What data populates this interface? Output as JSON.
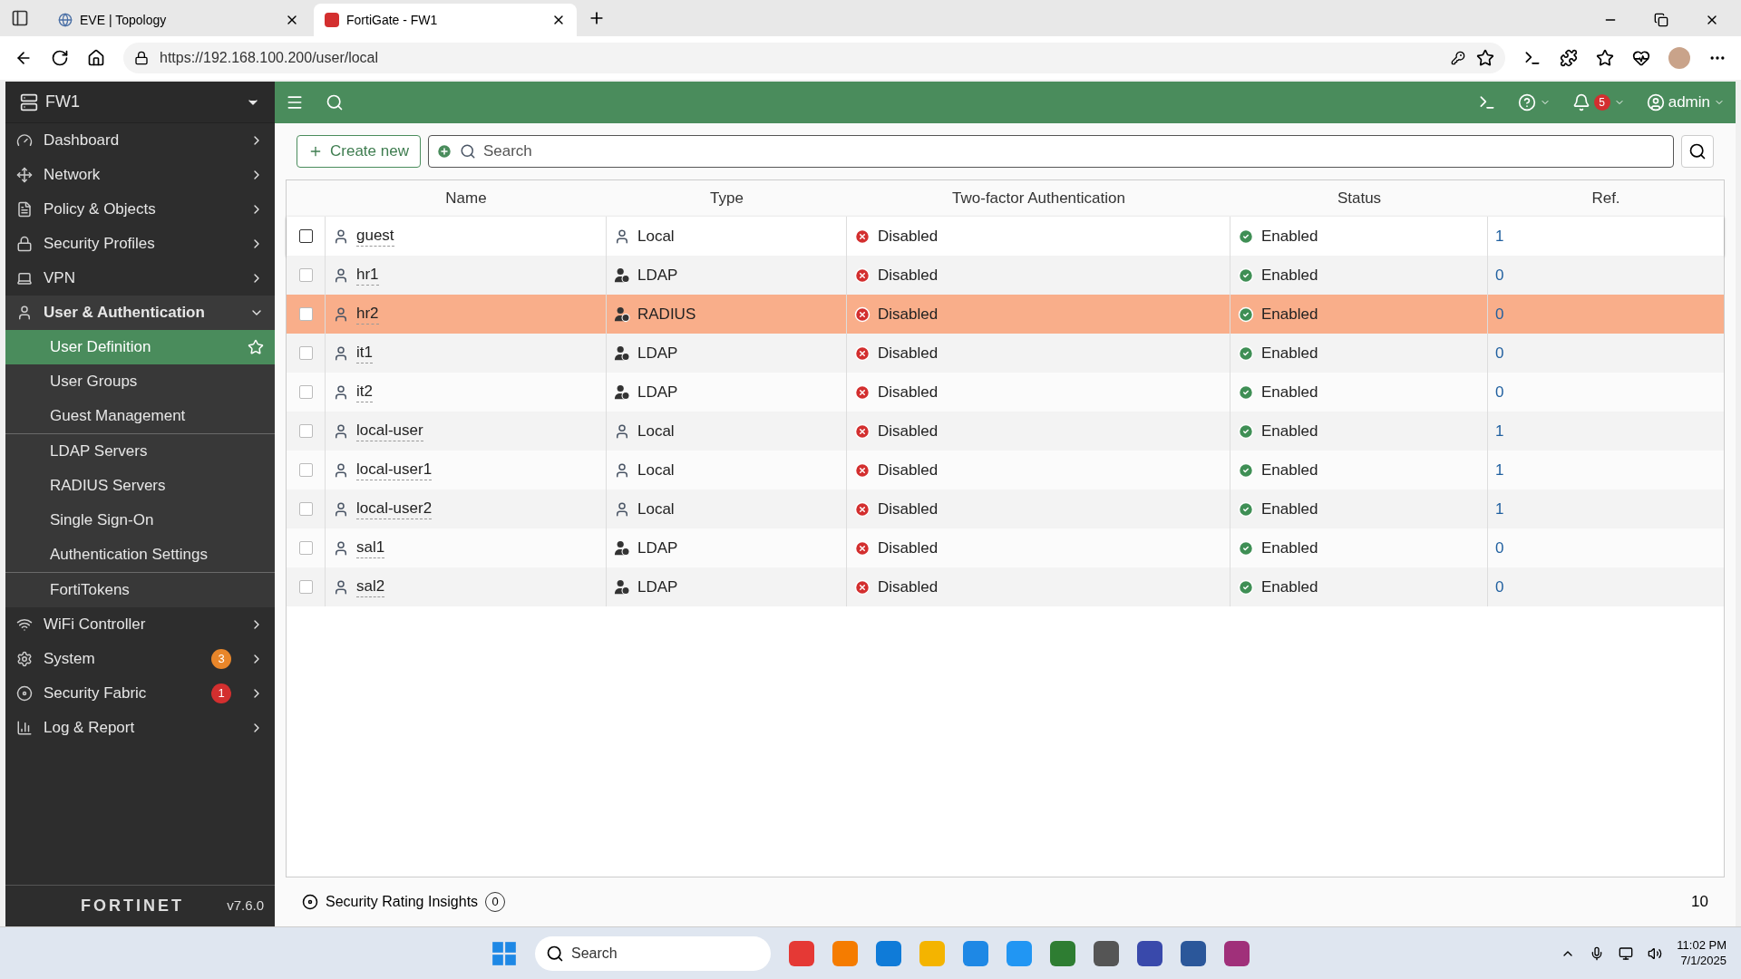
{
  "browser": {
    "tabs": [
      {
        "title": "EVE | Topology",
        "selected": false
      },
      {
        "title": "FortiGate - FW1",
        "selected": true
      }
    ],
    "url": "https://192.168.100.200/user/local"
  },
  "header": {
    "device": "FW1",
    "notifications": "5",
    "user": "admin"
  },
  "sidebar": {
    "items": [
      {
        "label": "Dashboard",
        "expanded": false
      },
      {
        "label": "Network",
        "expanded": false
      },
      {
        "label": "Policy & Objects",
        "expanded": false
      },
      {
        "label": "Security Profiles",
        "expanded": false
      },
      {
        "label": "VPN",
        "expanded": false
      },
      {
        "label": "User & Authentication",
        "expanded": true,
        "groups": [
          [
            {
              "label": "User Definition",
              "selected": true
            },
            {
              "label": "User Groups",
              "selected": false
            },
            {
              "label": "Guest Management",
              "selected": false
            }
          ],
          [
            {
              "label": "LDAP Servers",
              "selected": false
            },
            {
              "label": "RADIUS Servers",
              "selected": false
            },
            {
              "label": "Single Sign-On",
              "selected": false
            },
            {
              "label": "Authentication Settings",
              "selected": false
            }
          ],
          [
            {
              "label": "FortiTokens",
              "selected": false
            }
          ]
        ]
      },
      {
        "label": "WiFi Controller",
        "expanded": false
      },
      {
        "label": "System",
        "expanded": false,
        "badge": "3",
        "color": "#e8862a"
      },
      {
        "label": "Security Fabric",
        "expanded": false,
        "badge": "1",
        "color": "#d32f2f"
      },
      {
        "label": "Log & Report",
        "expanded": false
      }
    ],
    "logo": "FORTINET",
    "version": "v7.6.0"
  },
  "toolbar": {
    "create": "Create new",
    "search": {
      "placeholder": "Search"
    }
  },
  "table": {
    "columns": [
      "Name",
      "Type",
      "Two-factor Authentication",
      "Status",
      "Ref."
    ],
    "rows": [
      {
        "name": "guest",
        "type": "Local",
        "kind": "local",
        "tfa": "Disabled",
        "status": "Enabled",
        "ref": "1",
        "selected": false,
        "hovered": true
      },
      {
        "name": "hr1",
        "type": "LDAP",
        "kind": "remote",
        "tfa": "Disabled",
        "status": "Enabled",
        "ref": "0",
        "selected": false,
        "hovered": false
      },
      {
        "name": "hr2",
        "type": "RADIUS",
        "kind": "remote",
        "tfa": "Disabled",
        "status": "Enabled",
        "ref": "0",
        "selected": true,
        "hovered": false
      },
      {
        "name": "it1",
        "type": "LDAP",
        "kind": "remote",
        "tfa": "Disabled",
        "status": "Enabled",
        "ref": "0",
        "selected": false,
        "hovered": false
      },
      {
        "name": "it2",
        "type": "LDAP",
        "kind": "remote",
        "tfa": "Disabled",
        "status": "Enabled",
        "ref": "0",
        "selected": false,
        "hovered": false
      },
      {
        "name": "local-user",
        "type": "Local",
        "kind": "local",
        "tfa": "Disabled",
        "status": "Enabled",
        "ref": "1",
        "selected": false,
        "hovered": false
      },
      {
        "name": "local-user1",
        "type": "Local",
        "kind": "local",
        "tfa": "Disabled",
        "status": "Enabled",
        "ref": "1",
        "selected": false,
        "hovered": false
      },
      {
        "name": "local-user2",
        "type": "Local",
        "kind": "local",
        "tfa": "Disabled",
        "status": "Enabled",
        "ref": "1",
        "selected": false,
        "hovered": false
      },
      {
        "name": "sal1",
        "type": "LDAP",
        "kind": "remote",
        "tfa": "Disabled",
        "status": "Enabled",
        "ref": "0",
        "selected": false,
        "hovered": false
      },
      {
        "name": "sal2",
        "type": "LDAP",
        "kind": "remote",
        "tfa": "Disabled",
        "status": "Enabled",
        "ref": "0",
        "selected": false,
        "hovered": false
      }
    ]
  },
  "footer": {
    "insights": "Security Rating Insights",
    "insights_count": "0",
    "total": "10"
  },
  "taskbar": {
    "search": {
      "placeholder": "Search"
    },
    "time": "11:02 PM",
    "date": "7/1/2025"
  }
}
